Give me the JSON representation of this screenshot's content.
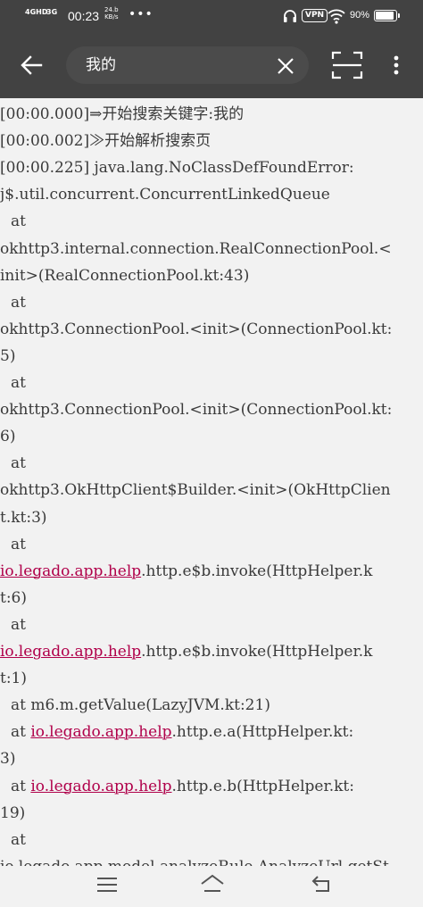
{
  "status_bar": {
    "network_1": "4GHD",
    "network_2": "3G",
    "time": "00:23",
    "speed_value": "24.b",
    "speed_unit": "KB/s",
    "dots": "•••",
    "vpn": "VPN",
    "battery": "90%",
    "battery_level": 0.9
  },
  "toolbar": {
    "search_text": "我的",
    "icons": [
      "back-arrow-icon",
      "clear-icon",
      "scan-icon",
      "more-vertical-icon"
    ]
  },
  "log": {
    "lines": [
      {
        "text": "[00:00.000]⇒开始搜索关键字:我的"
      },
      {
        "text": "[00:00.002]≫开始解析搜索页"
      },
      {
        "text": "[00:00.225] java.lang.NoClassDefFoundError:"
      },
      {
        "text": "j$.util.concurrent.ConcurrentLinkedQueue"
      },
      {
        "text": "at"
      },
      {
        "text": "okhttp3.internal.connection.RealConnectionPool.<"
      },
      {
        "text": "init>(RealConnectionPool.kt:43)"
      },
      {
        "text": "at"
      },
      {
        "text": "okhttp3.ConnectionPool.<init>(ConnectionPool.kt:"
      },
      {
        "text": "5)"
      },
      {
        "text": "at"
      },
      {
        "text": "okhttp3.ConnectionPool.<init>(ConnectionPool.kt:"
      },
      {
        "text": "6)"
      },
      {
        "text": "at"
      },
      {
        "text": "okhttp3.OkHttpClient$Builder.<init>(OkHttpClien"
      },
      {
        "text": "t.kt:3)"
      },
      {
        "text": "at"
      },
      {
        "link": "io.legado.app.help",
        "rest": ".http.e$b.invoke(HttpHelper.k"
      },
      {
        "text": "t:6)"
      },
      {
        "text": "at"
      },
      {
        "link": "io.legado.app.help",
        "rest": ".http.e$b.invoke(HttpHelper.k"
      },
      {
        "text": "t:1)"
      },
      {
        "text": "at m6.m.getValue(LazyJVM.kt:21)"
      },
      {
        "prefix": "at ",
        "link": "io.legado.app.help",
        "rest": ".http.e.a(HttpHelper.kt:"
      },
      {
        "text": "3)"
      },
      {
        "prefix": "at ",
        "link": "io.legado.app.help",
        "rest": ".http.e.b(HttpHelper.kt:"
      },
      {
        "text": "19)"
      },
      {
        "text": "at"
      },
      {
        "text": "io.legado.app.model.analyzeRule.AnalyzeUrl.getSt"
      }
    ]
  },
  "nav_bar": {
    "icons": [
      "menu-icon",
      "home-icon",
      "back-icon"
    ]
  },
  "colors": {
    "bar": "#424242",
    "search_box": "#4b4b4b",
    "background": "#f2f2f2",
    "text": "#3a3a3a",
    "link": "#b0004a"
  }
}
